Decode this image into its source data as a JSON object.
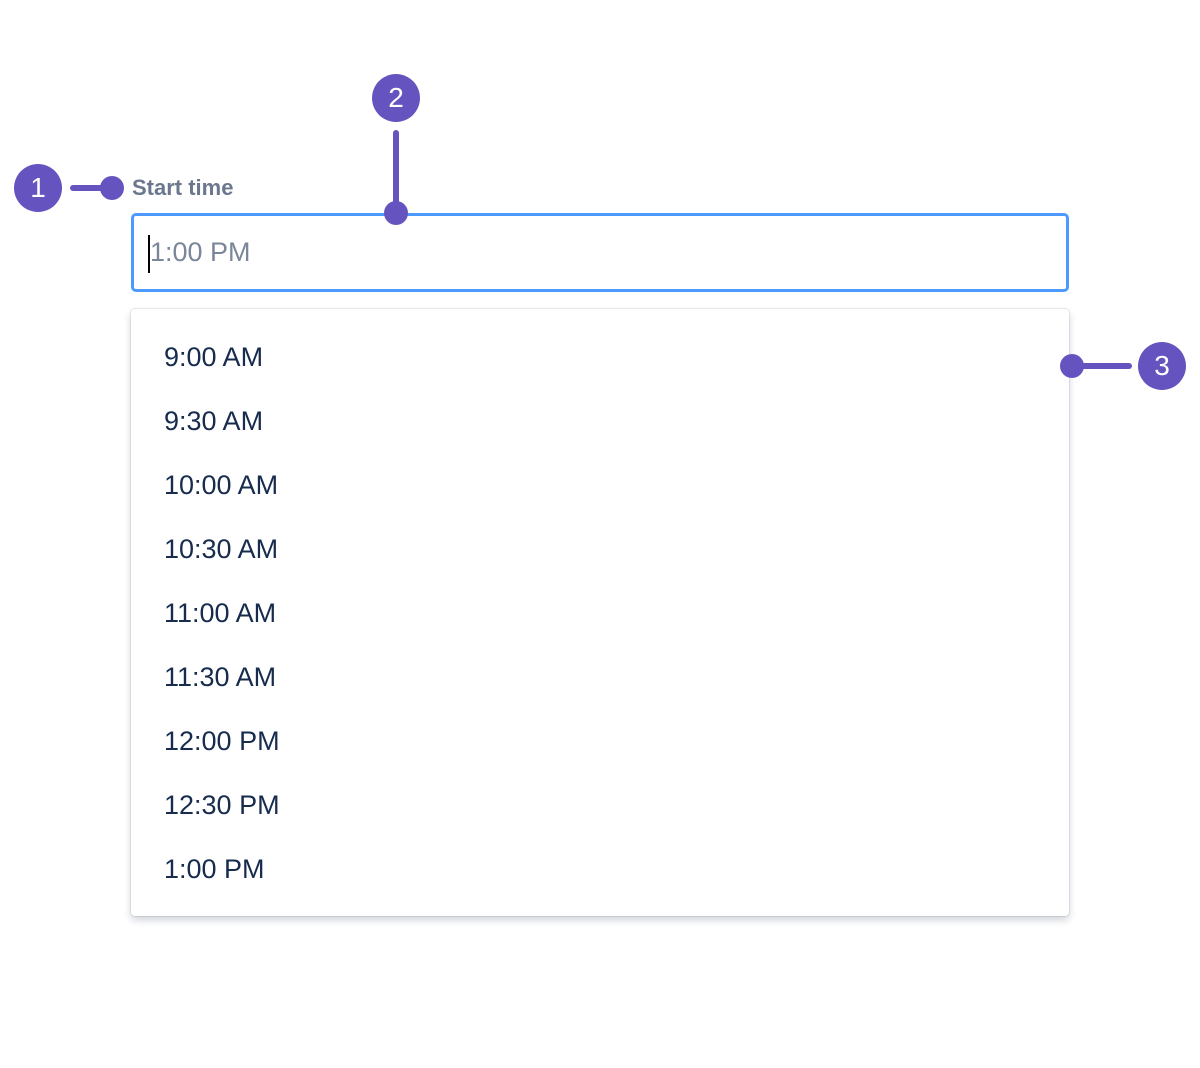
{
  "field": {
    "label": "Start time",
    "placeholder": "1:00 PM",
    "focused": true
  },
  "dropdown": {
    "options": [
      "9:00 AM",
      "9:30 AM",
      "10:00 AM",
      "10:30 AM",
      "11:00 AM",
      "11:30 AM",
      "12:00 PM",
      "12:30 PM",
      "1:00 PM"
    ]
  },
  "annotations": [
    "1",
    "2",
    "3"
  ],
  "colors": {
    "focus_border": "#4C9AFF",
    "annotation": "#6554C0",
    "label": "#6B778C",
    "option_text": "#172B4D",
    "placeholder": "#7A869A"
  }
}
